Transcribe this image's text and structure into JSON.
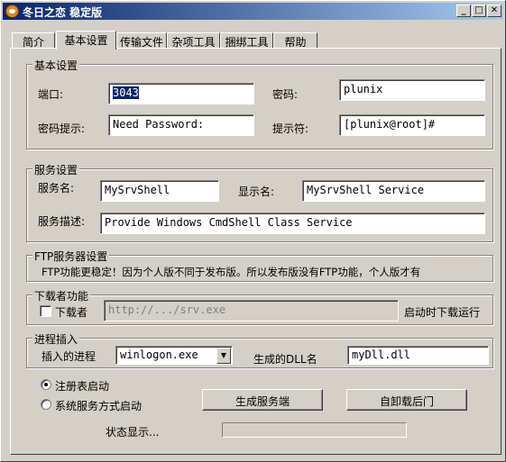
{
  "window": {
    "title": "冬日之恋 稳定版",
    "controls": {
      "minimize": "_",
      "maximize": "□",
      "close": "✕"
    }
  },
  "tabs": [
    "简介",
    "基本设置",
    "传输文件",
    "杂项工具",
    "捆绑工具",
    "帮助"
  ],
  "active_tab": "基本设置",
  "basic": {
    "title": "基本设置",
    "port_label": "端口:",
    "port_value": "3043",
    "password_label": "密码:",
    "password_value": "plunix",
    "hint_label": "密码提示:",
    "hint_value": "Need Password:",
    "prompt_label": "提示符:",
    "prompt_value": "[plunix@root]#"
  },
  "service": {
    "title": "服务设置",
    "name_label": "服务名:",
    "name_value": "MySrvShell",
    "display_label": "显示名:",
    "display_value": "MySrvShell Service",
    "desc_label": "服务描述:",
    "desc_value": "Provide Windows CmdShell Class Service"
  },
  "ftp": {
    "title": "FTP服务器设置",
    "note": "FTP功能更稳定！因为个人版不同于发布版。所以发布版没有FTP功能，个人版才有"
  },
  "downloader": {
    "title": "下载者功能",
    "checkbox_label": "下载者",
    "checked": false,
    "url_value": "http://.../srv.exe",
    "run_label": "启动时下载运行"
  },
  "inject": {
    "title": "进程插入",
    "process_label": "插入的进程",
    "process_value": "winlogon.exe",
    "dll_label": "生成的DLL名",
    "dll_value": "myDll.dll"
  },
  "startup": {
    "registry_label": "注册表启动",
    "service_label": "系统服务方式启动",
    "selected": "registry"
  },
  "buttons": {
    "generate": "生成服务端",
    "uninstall": "自卸载后门"
  },
  "status": {
    "label": "状态显示...",
    "progress": 0
  }
}
